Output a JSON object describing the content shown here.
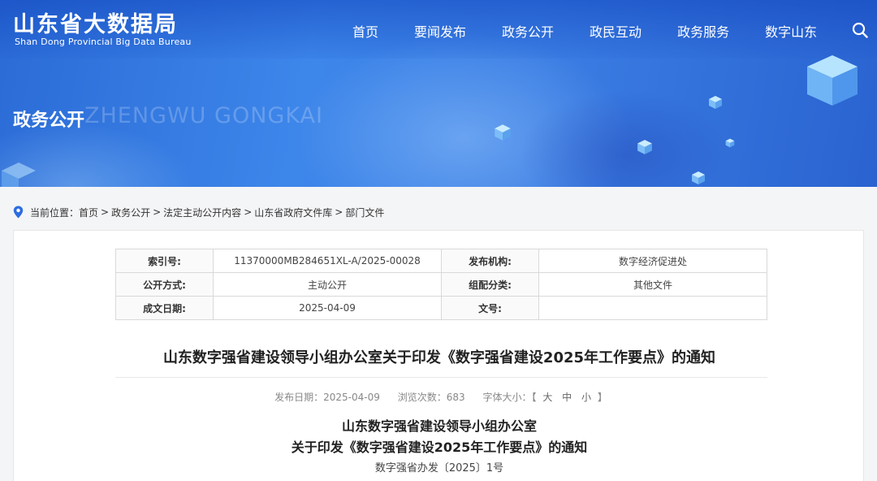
{
  "brand": {
    "name_cn": "山东省大数据局",
    "name_en": "Shan Dong Provincial Big Data Bureau"
  },
  "nav": {
    "items": [
      "首页",
      "要闻发布",
      "政务公开",
      "政民互动",
      "政务服务",
      "数字山东"
    ]
  },
  "section": {
    "title": "政务公开",
    "watermark": "ZHENGWU GONGKAI"
  },
  "breadcrumb": {
    "label": "当前位置：",
    "items": [
      "首页",
      "政务公开",
      "法定主动公开内容",
      "山东省政府文件库",
      "部门文件"
    ],
    "separator": ">"
  },
  "meta": {
    "rows": [
      {
        "k1": "索引号:",
        "v1": "11370000MB284651XL-A/2025-00028",
        "k2": "发布机构:",
        "v2": "数字经济促进处"
      },
      {
        "k1": "公开方式:",
        "v1": "主动公开",
        "k2": "组配分类:",
        "v2": "其他文件"
      },
      {
        "k1": "成文日期:",
        "v1": "2025-04-09",
        "k2": "文号:",
        "v2": ""
      }
    ]
  },
  "article": {
    "title": "山东数字强省建设领导小组办公室关于印发《数字强省建设2025年工作要点》的通知",
    "publish_label": "发布日期：",
    "publish_date": "2025-04-09",
    "views_label": "浏览次数：",
    "views": "683",
    "font_label": "字体大小：",
    "bracket_open": "【",
    "font_large": "大",
    "font_medium": "中",
    "font_small": "小",
    "bracket_close": "】",
    "head_line1": "山东数字强省建设领导小组办公室",
    "head_line2": "关于印发《数字强省建设2025年工作要点》的通知",
    "doc_number": "数字强省办发〔2025〕1号"
  },
  "colors": {
    "banner_primary": "#3d86ea",
    "accent_pin": "#2d6de0"
  },
  "icons": {
    "search": "search-icon",
    "location": "location-pin-icon"
  }
}
